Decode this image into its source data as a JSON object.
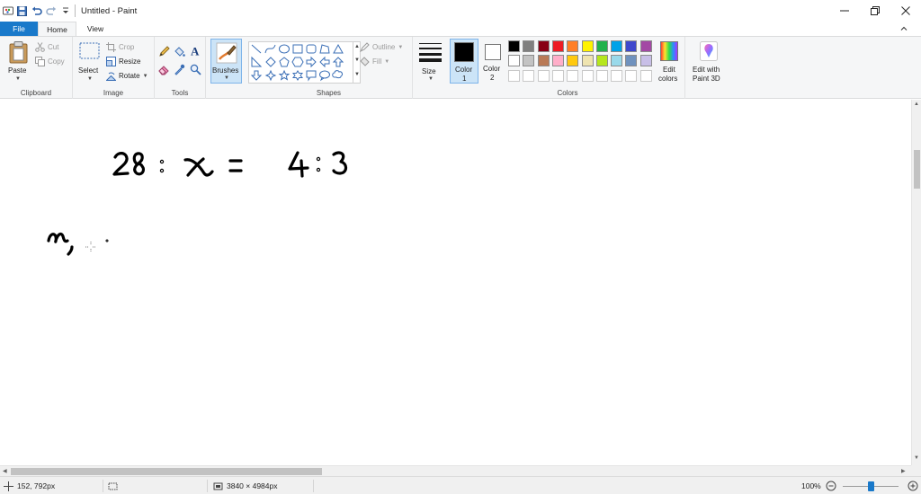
{
  "app": {
    "title": "Untitled - Paint"
  },
  "tabs": {
    "file": "File",
    "home": "Home",
    "view": "View"
  },
  "ribbon": {
    "clipboard": {
      "group_label": "Clipboard",
      "paste": "Paste",
      "cut": "Cut",
      "copy": "Copy"
    },
    "image": {
      "group_label": "Image",
      "select": "Select",
      "crop": "Crop",
      "resize": "Resize",
      "rotate": "Rotate"
    },
    "tools": {
      "group_label": "Tools"
    },
    "brushes": {
      "label": "Brushes"
    },
    "shapes": {
      "group_label": "Shapes",
      "outline": "Outline",
      "fill": "Fill"
    },
    "size": {
      "label": "Size"
    },
    "color1": {
      "label_line1": "Color",
      "label_line2": "1",
      "value": "#000000"
    },
    "color2": {
      "label_line1": "Color",
      "label_line2": "2",
      "value": "#ffffff"
    },
    "colors": {
      "group_label": "Colors",
      "edit_colors_line1": "Edit",
      "edit_colors_line2": "colors",
      "edit_paint3d_line1": "Edit with",
      "edit_paint3d_line2": "Paint 3D",
      "palette_row1": [
        "#000000",
        "#7f7f7f",
        "#880015",
        "#ed1c24",
        "#ff7f27",
        "#fff200",
        "#22b14c",
        "#00a2e8",
        "#3f48cc",
        "#a349a4"
      ],
      "palette_row2": [
        "#ffffff",
        "#c3c3c3",
        "#b97a57",
        "#ffaec9",
        "#ffc90e",
        "#efe4b0",
        "#b5e61d",
        "#99d9ea",
        "#7092be",
        "#c8bfe7"
      ],
      "custom_slots": 10
    }
  },
  "canvas": {
    "equation_tokens": [
      "28",
      ":",
      "x",
      "=",
      "4",
      ":",
      "3"
    ]
  },
  "statusbar": {
    "cursor_position": "152, 792px",
    "image_size": "3840 × 4984px",
    "zoom": "100%",
    "zoom_fraction": 0.5
  }
}
